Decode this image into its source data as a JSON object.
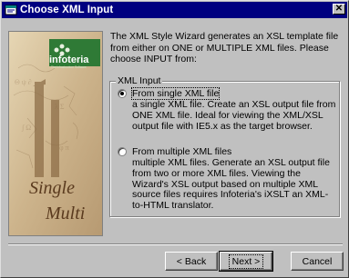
{
  "window": {
    "title": "Choose XML Input",
    "close_label": "✕"
  },
  "art": {
    "logo_text": "infoteria",
    "logo_subtext": "The Infrastructure Software",
    "word1": "Single",
    "word2": "Multi"
  },
  "intro_text": "The XML Style Wizard generates an XSL template file from either on ONE or MULTIPLE XML files. Please choose INPUT from:",
  "group": {
    "label": "XML Input",
    "option_single": {
      "label": "From single XML file",
      "selected": true,
      "description": "a single XML file. Create an XSL output file from ONE XML file. Ideal for viewing the XML/XSL output file with IE5.x as the target browser."
    },
    "option_multiple": {
      "label": "From multiple XML files",
      "selected": false,
      "description": "multiple XML files. Generate an XSL output file from two or more XML files. Viewing the Wizard's XSL output based on multiple XML source files requires Infoteria's iXSLT an XML-to-HTML translator."
    }
  },
  "buttons": {
    "back": "< Back",
    "next": "Next >",
    "cancel": "Cancel"
  },
  "colors": {
    "titlebar": "#000080",
    "face": "#c0c0c0"
  }
}
